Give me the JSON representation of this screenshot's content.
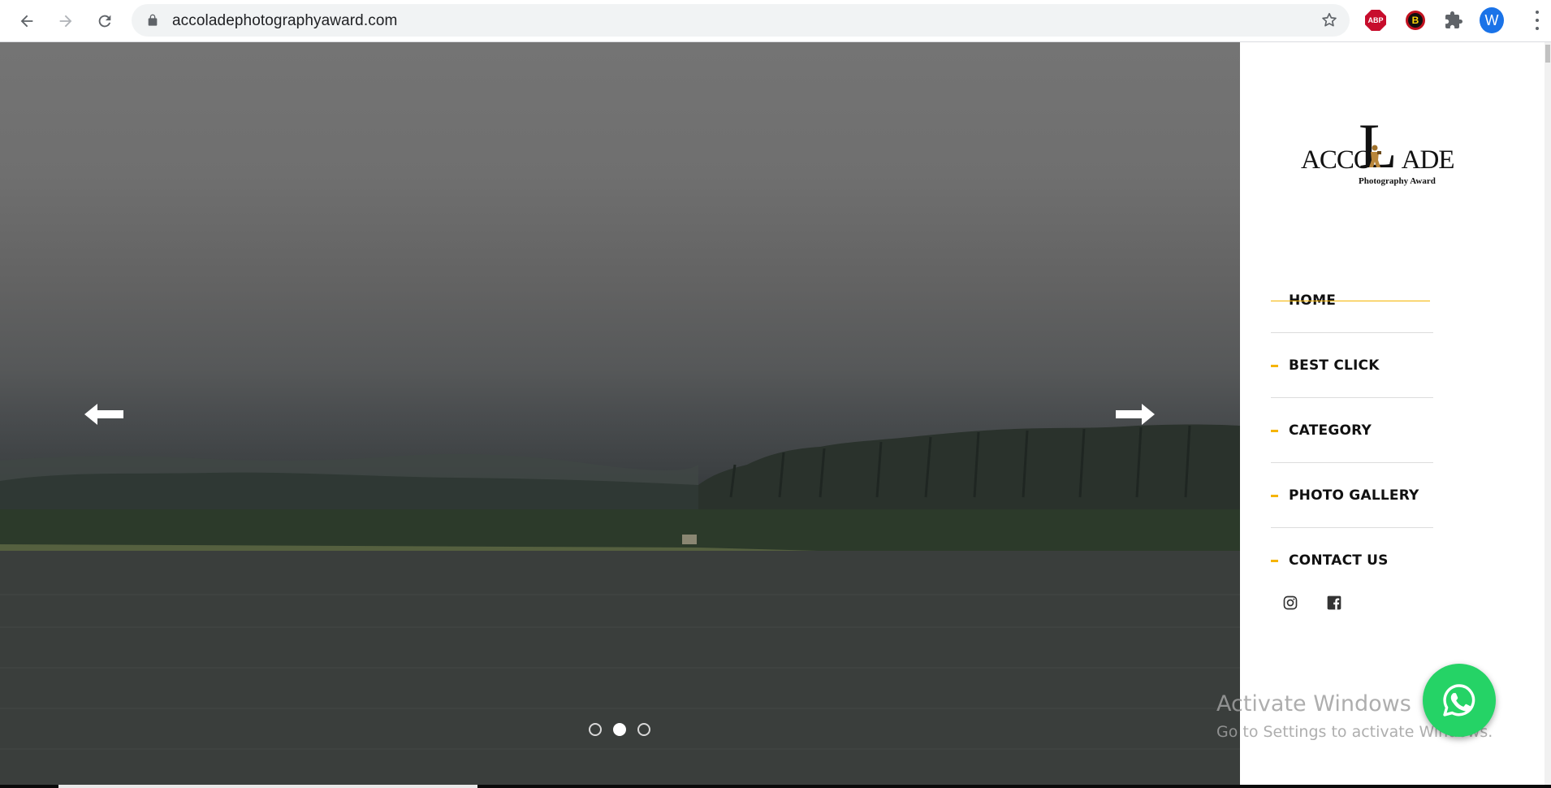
{
  "browser": {
    "url": "accoladephotographyaward.com",
    "icons": {
      "back": "arrow-left-icon",
      "forward": "arrow-right-icon",
      "reload": "reload-icon",
      "lock": "lock-icon",
      "bookmark": "star-icon",
      "extensions": "puzzle-icon",
      "menu": "kebab-icon"
    },
    "extensions": {
      "adblock_label": "ABP",
      "b_label": "B"
    },
    "profile_initial": "W"
  },
  "hero": {
    "slides": [
      {
        "active": false
      },
      {
        "active": true
      },
      {
        "active": false
      }
    ],
    "prev_icon": "arrow-left-icon",
    "next_icon": "arrow-right-icon"
  },
  "logo": {
    "word_left": "ACCO",
    "big_letter": "L",
    "word_right": "ADE",
    "subtitle": "Photography Award"
  },
  "nav": {
    "items": [
      {
        "label": "HOME",
        "active": true
      },
      {
        "label": "BEST CLICK",
        "active": false
      },
      {
        "label": "CATEGORY",
        "active": false
      },
      {
        "label": "PHOTO GALLERY",
        "active": false
      },
      {
        "label": "CONTACT US",
        "active": false
      }
    ]
  },
  "social": [
    "instagram-icon",
    "facebook-icon"
  ],
  "whatsapp": {
    "icon": "whatsapp-icon"
  },
  "watermark": {
    "title": "Activate Windows",
    "subtitle": "Go to Settings to activate Windows."
  },
  "colors": {
    "accent": "#f5b400",
    "whatsapp": "#25d366",
    "profile": "#1a73e8"
  }
}
